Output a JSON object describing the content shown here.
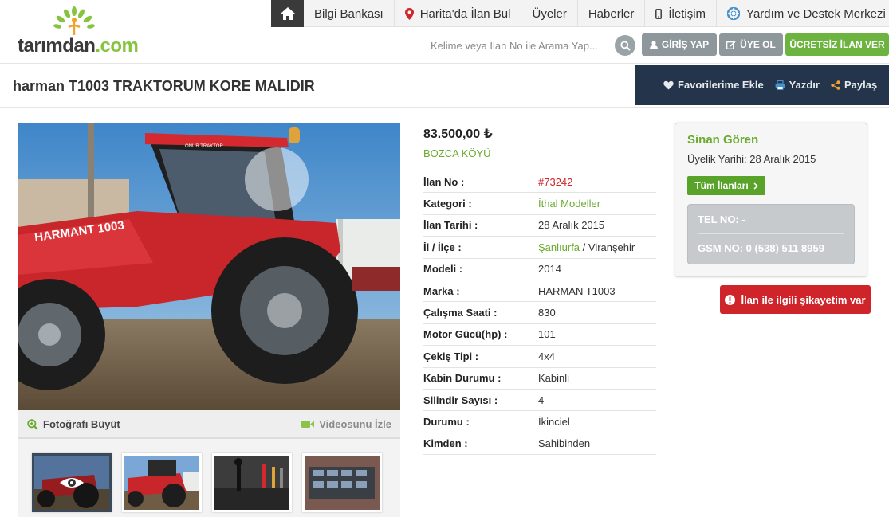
{
  "brand": {
    "logo_text": "tarımdan",
    "logo_suffix": ".com"
  },
  "topnav": {
    "items": [
      {
        "label": "Bilgi Bankası",
        "icon": ""
      },
      {
        "label": "Harita'da İlan Bul",
        "icon": "map-pin-icon"
      },
      {
        "label": "Üyeler",
        "icon": ""
      },
      {
        "label": "Haberler",
        "icon": ""
      },
      {
        "label": "İletişim",
        "icon": "mobile-phone-icon"
      },
      {
        "label": "Yardım ve Destek Merkezi",
        "icon": "lifebuoy-icon"
      }
    ]
  },
  "search": {
    "placeholder": "Kelime veya İlan No ile Arama Yap..."
  },
  "header_buttons": {
    "login": "GİRİŞ YAP",
    "register": "ÜYE OL",
    "free_ad": "ÜCRETSİZ İLAN VER"
  },
  "listing": {
    "title": "harman T1003 TRAKTORUM KORE MALIDIR",
    "price": "83.500,00 ₺",
    "location": "BOZCA KÖYÜ",
    "specs": [
      {
        "key": "İlan No :",
        "value": "#73242"
      },
      {
        "key": "Kategori :",
        "value": "İthal Modeller"
      },
      {
        "key": "İlan Tarihi :",
        "value": "28 Aralık 2015"
      },
      {
        "key": "İl / İlçe :",
        "value_link": "Şanlıurfa",
        "value_rest": " / Viranşehir"
      },
      {
        "key": "Modeli :",
        "value": "2014"
      },
      {
        "key": "Marka :",
        "value": "HARMAN T1003"
      },
      {
        "key": "Çalışma Saati :",
        "value": "830"
      },
      {
        "key": "Motor Gücü(hp) :",
        "value": "101"
      },
      {
        "key": "Çekiş Tipi :",
        "value": "4x4"
      },
      {
        "key": "Kabin Durumu :",
        "value": "Kabinli"
      },
      {
        "key": "Silindir Sayısı :",
        "value": "4"
      },
      {
        "key": "Durumu :",
        "value": "İkinciel"
      },
      {
        "key": "Kimden :",
        "value": "Sahibinden"
      }
    ]
  },
  "actions": {
    "favorite": "Favorilerime Ekle",
    "print": "Yazdır",
    "share": "Paylaş"
  },
  "photo": {
    "zoom_label": "Fotoğrafı Büyüt",
    "video_label": "Videosunu İzle",
    "tractor_text": "HARMANT 1003",
    "cab_text": "ONUR TRAKTOR"
  },
  "seller": {
    "name": "Sinan Gören",
    "since": "Üyelik Yarihi: 28 Aralık 2015",
    "all_ads": "Tüm İlanları",
    "tel": "TEL NO: -",
    "gsm": "GSM NO: 0 (538) 511 8959"
  },
  "complaint": "İlan ile ilgili şikayetim var",
  "colors": {
    "green": "#6aab2f",
    "navy": "#24344a",
    "red": "#d0242b",
    "grey_button": "#8e979c"
  }
}
